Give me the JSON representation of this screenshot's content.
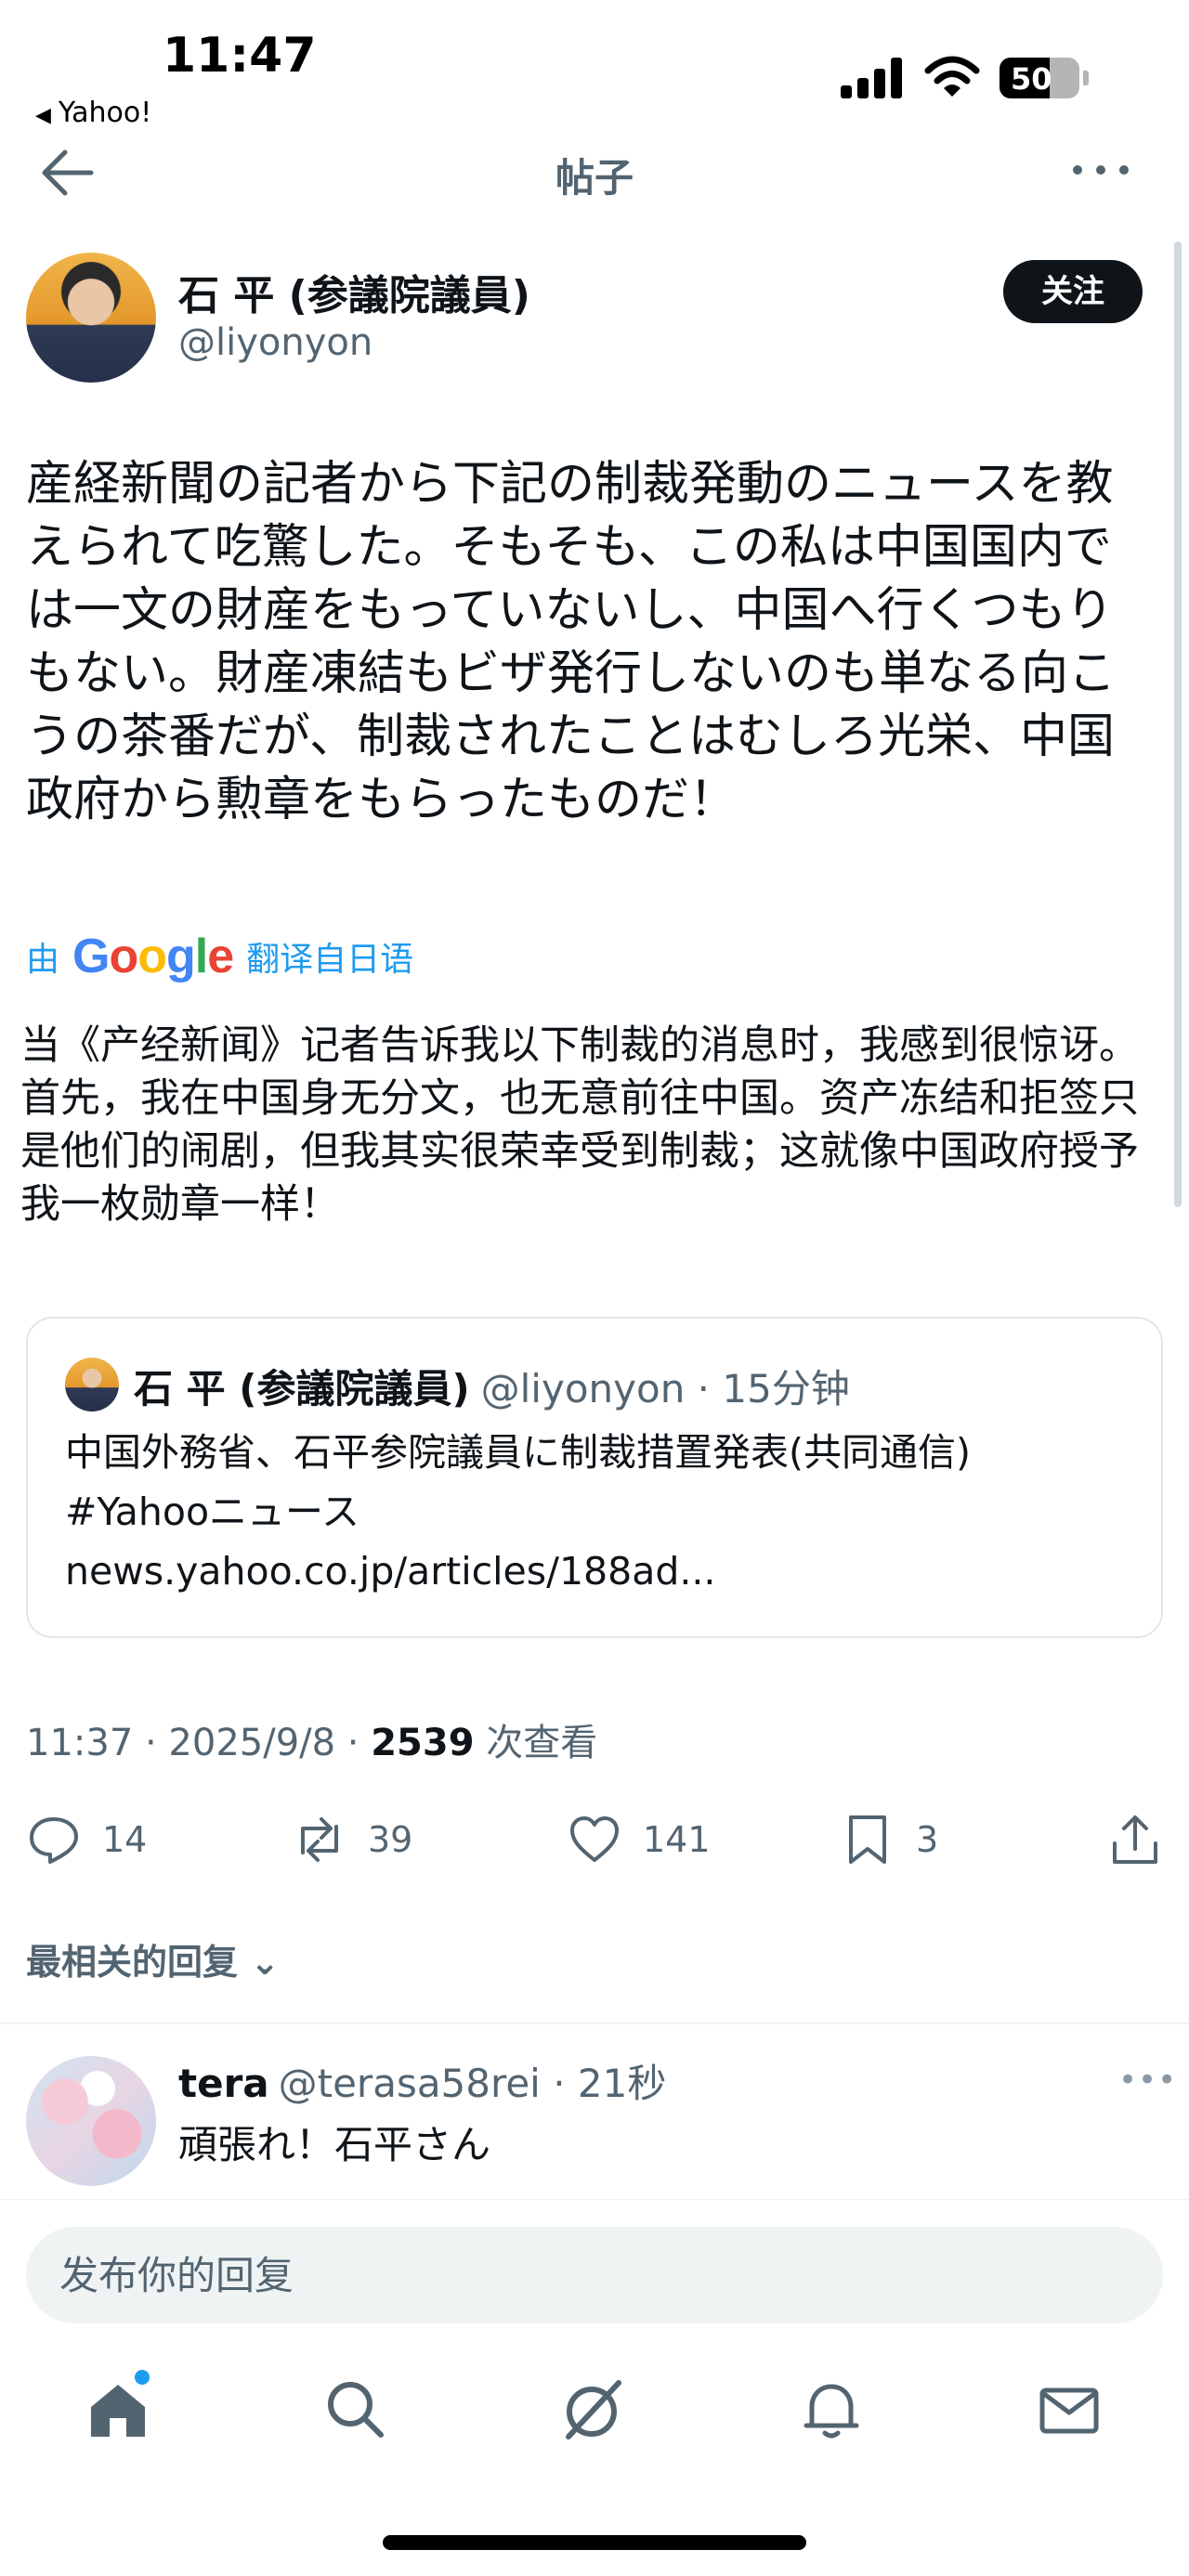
{
  "status_bar": {
    "time": "11:47",
    "back_app": "Yahoo!",
    "battery": "50"
  },
  "header": {
    "title": "帖子"
  },
  "post": {
    "author_name": "石 平 (参議院議員)",
    "author_handle": "@liyonyon",
    "follow_label": "关注",
    "original_text": "産経新聞の記者から下記の制裁発動のニュースを教えられて吃驚した。そもそも、この私は中国国内では一文の財産をもっていないし、中国へ行くつもりもない。財産凍結もビザ発行しないのも単なる向こうの茶番だが、制裁されたことはむしろ光栄、中国政府から勲章をもらったものだ！",
    "translate_prefix": "由",
    "translate_brand": "Google",
    "translate_suffix": "翻译自日语",
    "translated_text": "当《产经新闻》记者告诉我以下制裁的消息时，我感到很惊讶。首先，我在中国身无分文，也无意前往中国。资产冻结和拒签只是他们的闹剧，但我其实很荣幸受到制裁；这就像中国政府授予我一枚勋章一样！",
    "quote": {
      "name": "石 平 (参議院議員)",
      "meta": "@liyonyon · 15分钟",
      "body_line1": "中国外務省、石平参院議員に制裁措置発表(共同通信)",
      "body_line2": "#Yahooニュース",
      "body_line3": "news.yahoo.co.jp/articles/188ad..."
    },
    "meta_time": "11:37 · 2025/9/8 · ",
    "meta_views": "2539",
    "meta_views_label": " 次查看",
    "counts": {
      "replies": "14",
      "reposts": "39",
      "likes": "141",
      "bookmarks": "3"
    }
  },
  "replies_sort_label": "最相关的回复",
  "reply": {
    "name": "tera",
    "meta": "@terasa58rei · 21秒",
    "text": "頑張れ！石平さん"
  },
  "reply_input": {
    "placeholder": "发布你的回复"
  },
  "colors": {
    "accent": "#1d9bf0",
    "text": "#0f1419",
    "muted": "#536471"
  },
  "icons": [
    "back-arrow-icon",
    "more-icon",
    "reply-icon",
    "repost-icon",
    "like-icon",
    "bookmark-icon",
    "share-icon",
    "chevron-down-icon",
    "home-icon",
    "search-icon",
    "grok-icon",
    "bell-icon",
    "mail-icon"
  ]
}
